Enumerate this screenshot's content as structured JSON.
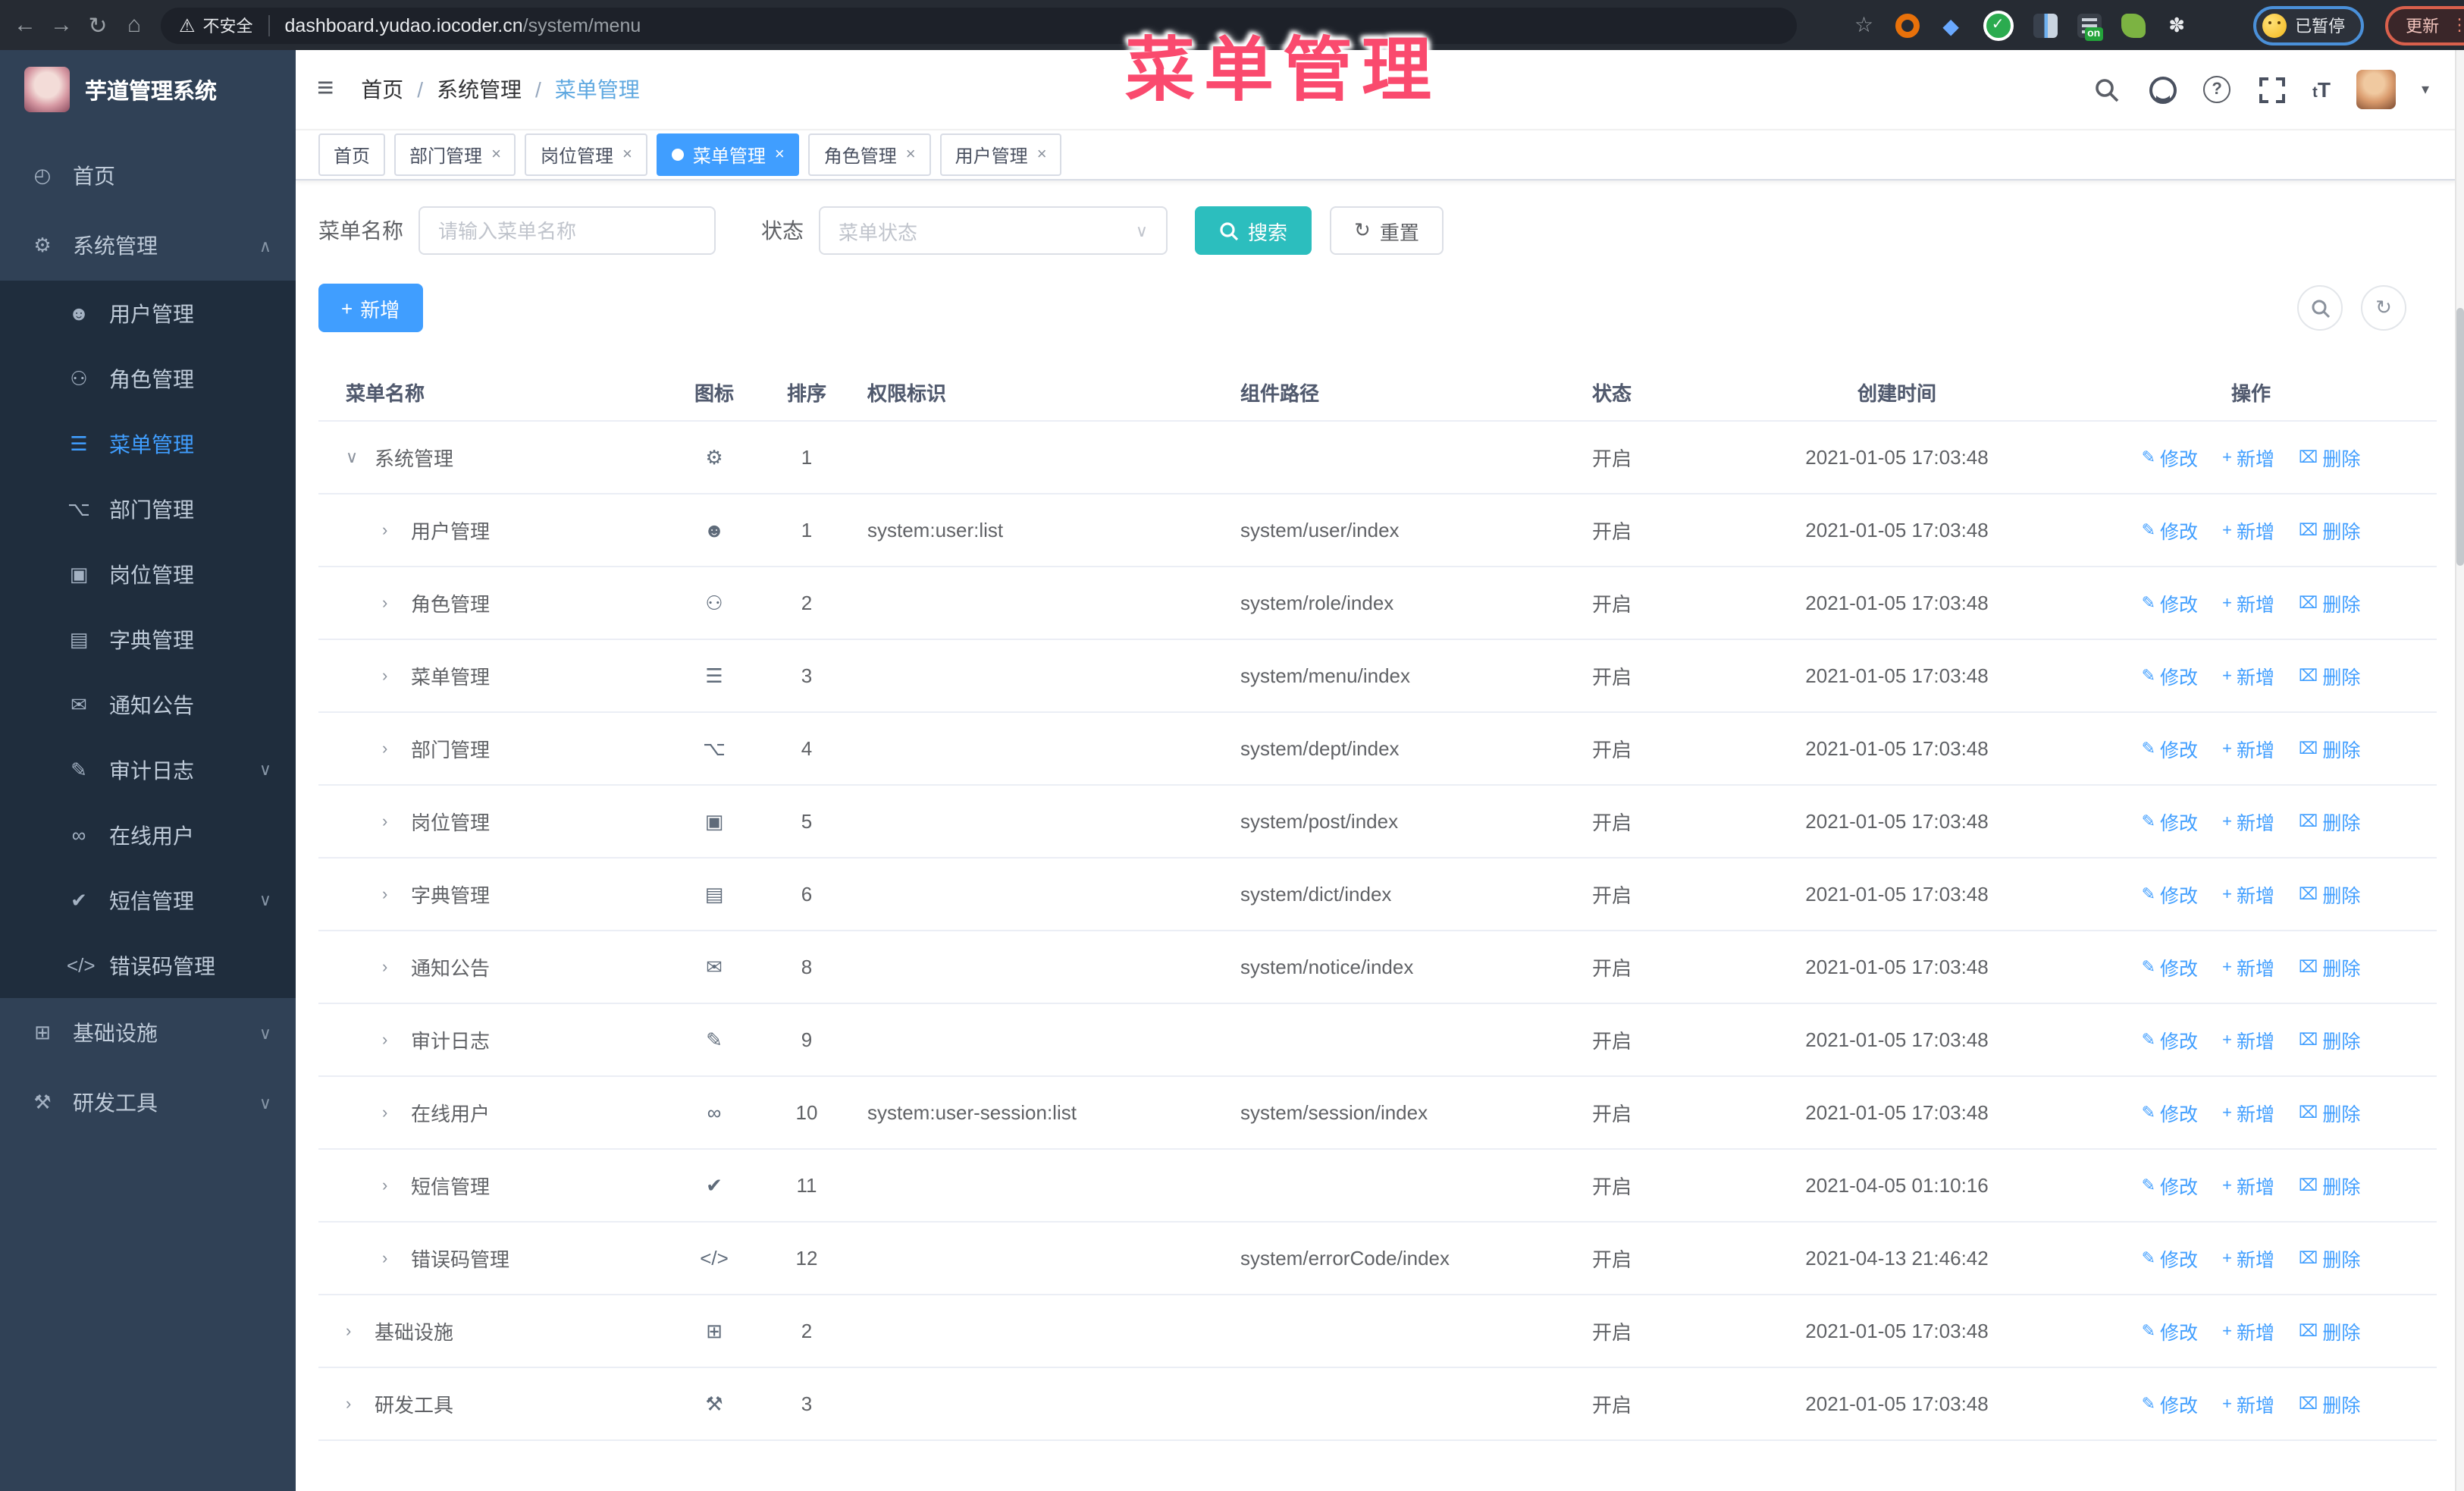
{
  "colors": {
    "accent": "#409EFF",
    "search_button": "#2cbebe",
    "overlay_pink": "#fa4a6e",
    "sidebar_bg": "#304156",
    "submenu_bg": "#1f2d3d"
  },
  "icons": {
    "back": "←",
    "forward": "→",
    "reload": "↻",
    "home": "⌂",
    "warning": "⚠",
    "star": "☆",
    "gem": "◆",
    "check": "✓",
    "puzzle": "✽",
    "menu_toggle": "≡",
    "caret_down": "▾",
    "chevron_up": "∧",
    "chevron_down": "∨",
    "select_caret": "∨",
    "reset": "↻",
    "plus": "+",
    "edit": "✎",
    "delete": "⌧",
    "dots": "⋮",
    "help": "?",
    "font_size_big": "T",
    "font_size_small": "t",
    "close": "×"
  },
  "browser": {
    "security_label": "不安全",
    "url_host": "dashboard.yudao.iocoder.cn",
    "url_path": "/system/menu",
    "on_badge": "on",
    "paused_label": "已暂停",
    "update_label": "更新"
  },
  "overlay": {
    "title": "菜单管理"
  },
  "sidebar": {
    "app_title": "芋道管理系统",
    "items": [
      {
        "label": "首页",
        "glyph": "◴",
        "chevron": ""
      },
      {
        "label": "系统管理",
        "glyph": "⚙",
        "chevron": "∧"
      },
      {
        "label": "用户管理",
        "glyph": "☻",
        "chevron": ""
      },
      {
        "label": "角色管理",
        "glyph": "⚇",
        "chevron": ""
      },
      {
        "label": "菜单管理",
        "glyph": "☰",
        "chevron": ""
      },
      {
        "label": "部门管理",
        "glyph": "⌥",
        "chevron": ""
      },
      {
        "label": "岗位管理",
        "glyph": "▣",
        "chevron": ""
      },
      {
        "label": "字典管理",
        "glyph": "▤",
        "chevron": ""
      },
      {
        "label": "通知公告",
        "glyph": "✉",
        "chevron": ""
      },
      {
        "label": "审计日志",
        "glyph": "✎",
        "chevron": "∨"
      },
      {
        "label": "在线用户",
        "glyph": "∞",
        "chevron": ""
      },
      {
        "label": "短信管理",
        "glyph": "✔",
        "chevron": "∨"
      },
      {
        "label": "错误码管理",
        "glyph": "</>",
        "chevron": ""
      },
      {
        "label": "基础设施",
        "glyph": "⊞",
        "chevron": "∨"
      },
      {
        "label": "研发工具",
        "glyph": "⚒",
        "chevron": "∨"
      }
    ]
  },
  "header": {
    "breadcrumb": [
      "首页",
      "系统管理",
      "菜单管理"
    ],
    "separator": "/"
  },
  "tabs": [
    {
      "label": "首页"
    },
    {
      "label": "部门管理"
    },
    {
      "label": "岗位管理"
    },
    {
      "label": "菜单管理"
    },
    {
      "label": "角色管理"
    },
    {
      "label": "用户管理"
    }
  ],
  "filters": {
    "name_label": "菜单名称",
    "name_placeholder": "请输入菜单名称",
    "status_label": "状态",
    "status_placeholder": "菜单状态",
    "search_label": "搜索",
    "reset_label": "重置"
  },
  "toolbar": {
    "add_label": "新增"
  },
  "table": {
    "headers": [
      "菜单名称",
      "图标",
      "排序",
      "权限标识",
      "组件路径",
      "状态",
      "创建时间",
      "操作"
    ],
    "action_labels": {
      "edit": "修改",
      "add": "新增",
      "delete": "删除"
    },
    "rows": [
      {
        "name": "系统管理",
        "glyph": "⚙",
        "sort": "1",
        "perm": "",
        "path": "",
        "status": "开启",
        "time": "2021-01-05 17:03:48",
        "expand": "∨"
      },
      {
        "name": "用户管理",
        "glyph": "☻",
        "sort": "1",
        "perm": "system:user:list",
        "path": "system/user/index",
        "status": "开启",
        "time": "2021-01-05 17:03:48",
        "expand": "›"
      },
      {
        "name": "角色管理",
        "glyph": "⚇",
        "sort": "2",
        "perm": "",
        "path": "system/role/index",
        "status": "开启",
        "time": "2021-01-05 17:03:48",
        "expand": "›"
      },
      {
        "name": "菜单管理",
        "glyph": "☰",
        "sort": "3",
        "perm": "",
        "path": "system/menu/index",
        "status": "开启",
        "time": "2021-01-05 17:03:48",
        "expand": "›"
      },
      {
        "name": "部门管理",
        "glyph": "⌥",
        "sort": "4",
        "perm": "",
        "path": "system/dept/index",
        "status": "开启",
        "time": "2021-01-05 17:03:48",
        "expand": "›"
      },
      {
        "name": "岗位管理",
        "glyph": "▣",
        "sort": "5",
        "perm": "",
        "path": "system/post/index",
        "status": "开启",
        "time": "2021-01-05 17:03:48",
        "expand": "›"
      },
      {
        "name": "字典管理",
        "glyph": "▤",
        "sort": "6",
        "perm": "",
        "path": "system/dict/index",
        "status": "开启",
        "time": "2021-01-05 17:03:48",
        "expand": "›"
      },
      {
        "name": "通知公告",
        "glyph": "✉",
        "sort": "8",
        "perm": "",
        "path": "system/notice/index",
        "status": "开启",
        "time": "2021-01-05 17:03:48",
        "expand": "›"
      },
      {
        "name": "审计日志",
        "glyph": "✎",
        "sort": "9",
        "perm": "",
        "path": "",
        "status": "开启",
        "time": "2021-01-05 17:03:48",
        "expand": "›"
      },
      {
        "name": "在线用户",
        "glyph": "∞",
        "sort": "10",
        "perm": "system:user-session:list",
        "path": "system/session/index",
        "status": "开启",
        "time": "2021-01-05 17:03:48",
        "expand": "›"
      },
      {
        "name": "短信管理",
        "glyph": "✔",
        "sort": "11",
        "perm": "",
        "path": "",
        "status": "开启",
        "time": "2021-04-05 01:10:16",
        "expand": "›"
      },
      {
        "name": "错误码管理",
        "glyph": "</>",
        "sort": "12",
        "perm": "",
        "path": "system/errorCode/index",
        "status": "开启",
        "time": "2021-04-13 21:46:42",
        "expand": "›"
      },
      {
        "name": "基础设施",
        "glyph": "⊞",
        "sort": "2",
        "perm": "",
        "path": "",
        "status": "开启",
        "time": "2021-01-05 17:03:48",
        "expand": "›"
      },
      {
        "name": "研发工具",
        "glyph": "⚒",
        "sort": "3",
        "perm": "",
        "path": "",
        "status": "开启",
        "time": "2021-01-05 17:03:48",
        "expand": "›"
      }
    ]
  }
}
